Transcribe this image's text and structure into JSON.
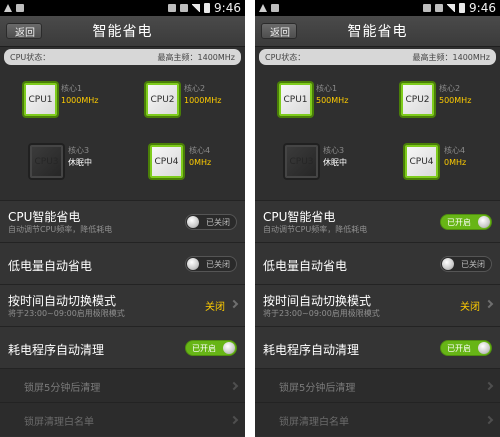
{
  "screens": [
    {
      "status": {
        "time": "9:46"
      },
      "title": "智能省电",
      "back_label": "返回",
      "cpu_status": {
        "label": "CPU状态：",
        "max_freq": "最高主频：1400MHz"
      },
      "cpus": [
        {
          "chip": "CPU1",
          "core_label": "核心1",
          "value": "1000MHz",
          "state": "on"
        },
        {
          "chip": "CPU2",
          "core_label": "核心2",
          "value": "1000MHz",
          "state": "on"
        },
        {
          "chip": "CPU3",
          "core_label": "核心3",
          "value": "休眠中",
          "state": "sleep"
        },
        {
          "chip": "CPU4",
          "core_label": "核心4",
          "value": "0MHz",
          "state": "on"
        }
      ],
      "rows": [
        {
          "title": "CPU智能省电",
          "subtitle": "自动调节CPU频率，降低耗电",
          "toggle": {
            "label": "已关闭",
            "on": false
          }
        },
        {
          "title": "低电量自动省电",
          "toggle": {
            "label": "已关闭",
            "on": false
          }
        },
        {
          "title": "按时间自动切换模式",
          "subtitle": "将于23:00~09:00启用极限模式",
          "value": "关闭"
        },
        {
          "title": "耗电程序自动清理",
          "toggle": {
            "label": "已开启",
            "on": true
          }
        },
        {
          "title": "锁屏5分钟后清理"
        },
        {
          "title": "锁屏清理白名单"
        }
      ]
    },
    {
      "status": {
        "time": "9:46"
      },
      "title": "智能省电",
      "back_label": "返回",
      "cpu_status": {
        "label": "CPU状态：",
        "max_freq": "最高主频：1400MHz"
      },
      "cpus": [
        {
          "chip": "CPU1",
          "core_label": "核心1",
          "value": "500MHz",
          "state": "on"
        },
        {
          "chip": "CPU2",
          "core_label": "核心2",
          "value": "500MHz",
          "state": "on"
        },
        {
          "chip": "CPU3",
          "core_label": "核心3",
          "value": "休眠中",
          "state": "sleep"
        },
        {
          "chip": "CPU4",
          "core_label": "核心4",
          "value": "0MHz",
          "state": "on"
        }
      ],
      "rows": [
        {
          "title": "CPU智能省电",
          "subtitle": "自动调节CPU频率，降低耗电",
          "toggle": {
            "label": "已开启",
            "on": true
          }
        },
        {
          "title": "低电量自动省电",
          "toggle": {
            "label": "已关闭",
            "on": false
          }
        },
        {
          "title": "按时间自动切换模式",
          "subtitle": "将于23:00~09:00启用极限模式",
          "value": "关闭"
        },
        {
          "title": "耗电程序自动清理",
          "toggle": {
            "label": "已开启",
            "on": true
          }
        },
        {
          "title": "锁屏5分钟后清理"
        },
        {
          "title": "锁屏清理白名单"
        }
      ]
    }
  ],
  "colors": {
    "accent_green": "#67b516",
    "accent_yellow": "#ffcc00"
  },
  "icons": {
    "status_icons": [
      "warning-icon",
      "app-icon",
      "alarm-icon",
      "wifi-icon",
      "signal-icon",
      "battery-icon"
    ],
    "back": "back-arrow-icon",
    "chevron": "chevron-right-icon"
  }
}
